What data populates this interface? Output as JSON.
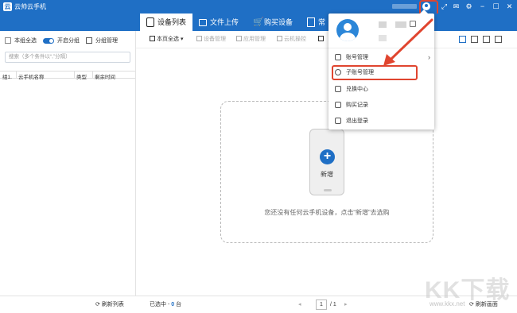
{
  "window": {
    "title": "云帅云手机",
    "logo": "云"
  },
  "colors": {
    "brand": "#1f6fc5",
    "annotation": "#e0452f"
  },
  "titlebar_icons": [
    "avatar-icon",
    "screenshot-icon",
    "mail-icon",
    "gear-icon",
    "minimize-icon",
    "maximize-icon",
    "close-icon"
  ],
  "tabs": [
    {
      "label": "设备列表",
      "icon": "phone-icon",
      "active": true
    },
    {
      "label": "文件上传",
      "icon": "folder-icon",
      "active": false
    },
    {
      "label": "购买设备",
      "icon": "cart-icon",
      "active": false
    },
    {
      "label": "常",
      "icon": "list-icon",
      "active": false
    }
  ],
  "left": {
    "select_all": "本组全选",
    "toggle_label": "开启分组",
    "group_manage": "分组管理",
    "search_placeholder": "搜索（多个条件以“,”分隔）",
    "columns": [
      "组1.",
      "云手机名称",
      "类型",
      "剩余时间"
    ]
  },
  "toolbar": {
    "page_select": "本页全选",
    "device_manage": "设备管理",
    "app_manage": "应用管理",
    "cloud_control": "云机操控"
  },
  "menu": {
    "account_manage": "账号管理",
    "sub_account_manage": "子账号管理",
    "redeem_center": "兑换中心",
    "purchase_records": "购买记录",
    "logout": "退出登录"
  },
  "main": {
    "add_label": "新增",
    "empty_text": "您还没有任何云手机设备，点击“新增”去选购"
  },
  "bottom": {
    "refresh_list": "刷新列表",
    "selected_prefix": "已选中 -",
    "selected_count": "0",
    "selected_unit": "台",
    "page_current": "1",
    "page_total": "/ 1",
    "refresh_screen": "刷新画面"
  },
  "watermark": {
    "text": "KK下载",
    "url": "www.kkx.net"
  }
}
